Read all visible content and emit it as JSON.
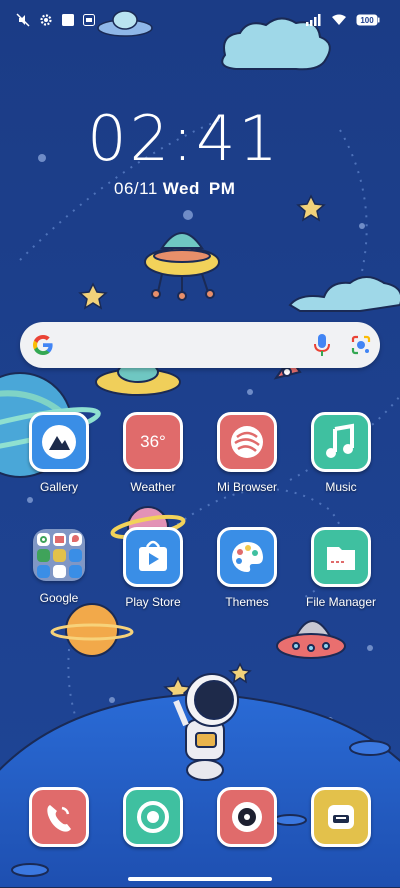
{
  "status_bar": {
    "icons": [
      "mute-icon",
      "gear-icon",
      "square-notification-icon",
      "sim-icon",
      "signal-icon",
      "wifi-icon"
    ],
    "battery": "100"
  },
  "clock": {
    "time": "02:41",
    "date": "06/11",
    "day": "Wed",
    "ampm": "PM"
  },
  "search": {
    "icons": [
      "google-logo-icon",
      "mic-icon",
      "lens-icon"
    ]
  },
  "apps": [
    {
      "label": "Gallery",
      "icon": "gallery-icon",
      "color": "#3a8ee6"
    },
    {
      "label": "Weather",
      "icon": "weather-icon",
      "color": "#e06b6b",
      "value": "36°"
    },
    {
      "label": "Mi Browser",
      "icon": "browser-icon",
      "color": "#e06b6b"
    },
    {
      "label": "Music",
      "icon": "music-icon",
      "color": "#3fc0a0"
    },
    {
      "label": "Google",
      "icon": "folder-icon",
      "color": "#b7c7e6"
    },
    {
      "label": "Play Store",
      "icon": "play-store-icon",
      "color": "#3a8ee6"
    },
    {
      "label": "Themes",
      "icon": "themes-icon",
      "color": "#3a8ee6"
    },
    {
      "label": "File Manager",
      "icon": "file-manager-icon",
      "color": "#3fc0a0"
    }
  ],
  "dock": [
    {
      "icon": "phone-icon",
      "color": "#e06b6b"
    },
    {
      "icon": "chrome-icon",
      "color": "#3fc0a0"
    },
    {
      "icon": "camera-icon",
      "color": "#e06b6b"
    },
    {
      "icon": "messages-icon",
      "color": "#e3c14b"
    }
  ],
  "colors": {
    "background": "#1d3f8f",
    "accent_red": "#e06b6b",
    "accent_teal": "#3fc0a0",
    "accent_blue": "#3a8ee6"
  }
}
